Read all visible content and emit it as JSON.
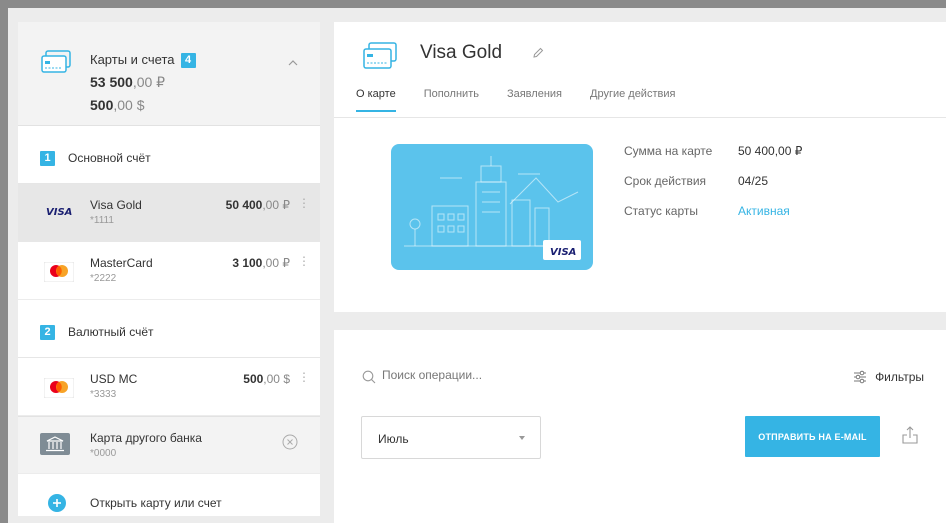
{
  "sidebar": {
    "header": {
      "title": "Карты и счета",
      "count": "4",
      "rub_main": "53 500",
      "rub_frac": ",00 ₽",
      "usd_main": "500",
      "usd_frac": ",00 $"
    },
    "groups": [
      {
        "index": "1",
        "label": "Основной счёт",
        "cards": [
          {
            "brand": "VISA",
            "name": "Visa Gold",
            "number": "*1111",
            "amount_main": "50 400",
            "amount_frac": ",00 ₽"
          },
          {
            "brand": "mastercard",
            "name": "MasterCard",
            "number": "*2222",
            "amount_main": "3 100",
            "amount_frac": ",00 ₽"
          }
        ]
      },
      {
        "index": "2",
        "label": "Валютный счёт",
        "cards": [
          {
            "brand": "mastercard",
            "name": "USD MC",
            "number": "*3333",
            "amount_main": "500",
            "amount_frac": ",00 $"
          }
        ]
      }
    ],
    "other_bank": {
      "name": "Карта другого банка",
      "number": "*0000"
    },
    "open_label": "Открыть карту или счет"
  },
  "card_panel": {
    "title": "Visa Gold",
    "tabs": [
      "О карте",
      "Пополнить",
      "Заявления",
      "Другие действия"
    ],
    "card_brand": "VISA",
    "info": [
      {
        "key": "Сумма на карте",
        "value": "50 400,00 ₽"
      },
      {
        "key": "Срок действия",
        "value": "04/25"
      },
      {
        "key": "Статус карты",
        "value": "Активная"
      }
    ]
  },
  "operations": {
    "search_placeholder": "Поиск операции...",
    "filters_label": "Фильтры",
    "month_value": "Июль",
    "email_button": "ОТПРАВИТЬ НА E-MAIL"
  },
  "colors": {
    "accent": "#35b4e4",
    "visa_blue": "#1a1f71",
    "mc_red": "#eb001b",
    "mc_orange": "#f79e1b"
  },
  "icons": [
    "cards-icon",
    "chevron-up-icon",
    "visa-logo",
    "mastercard-logo",
    "bank-icon",
    "close-circle-icon",
    "plus-circle-icon",
    "pencil-icon",
    "search-icon",
    "filter-icon",
    "chevron-down-icon",
    "share-icon"
  ]
}
